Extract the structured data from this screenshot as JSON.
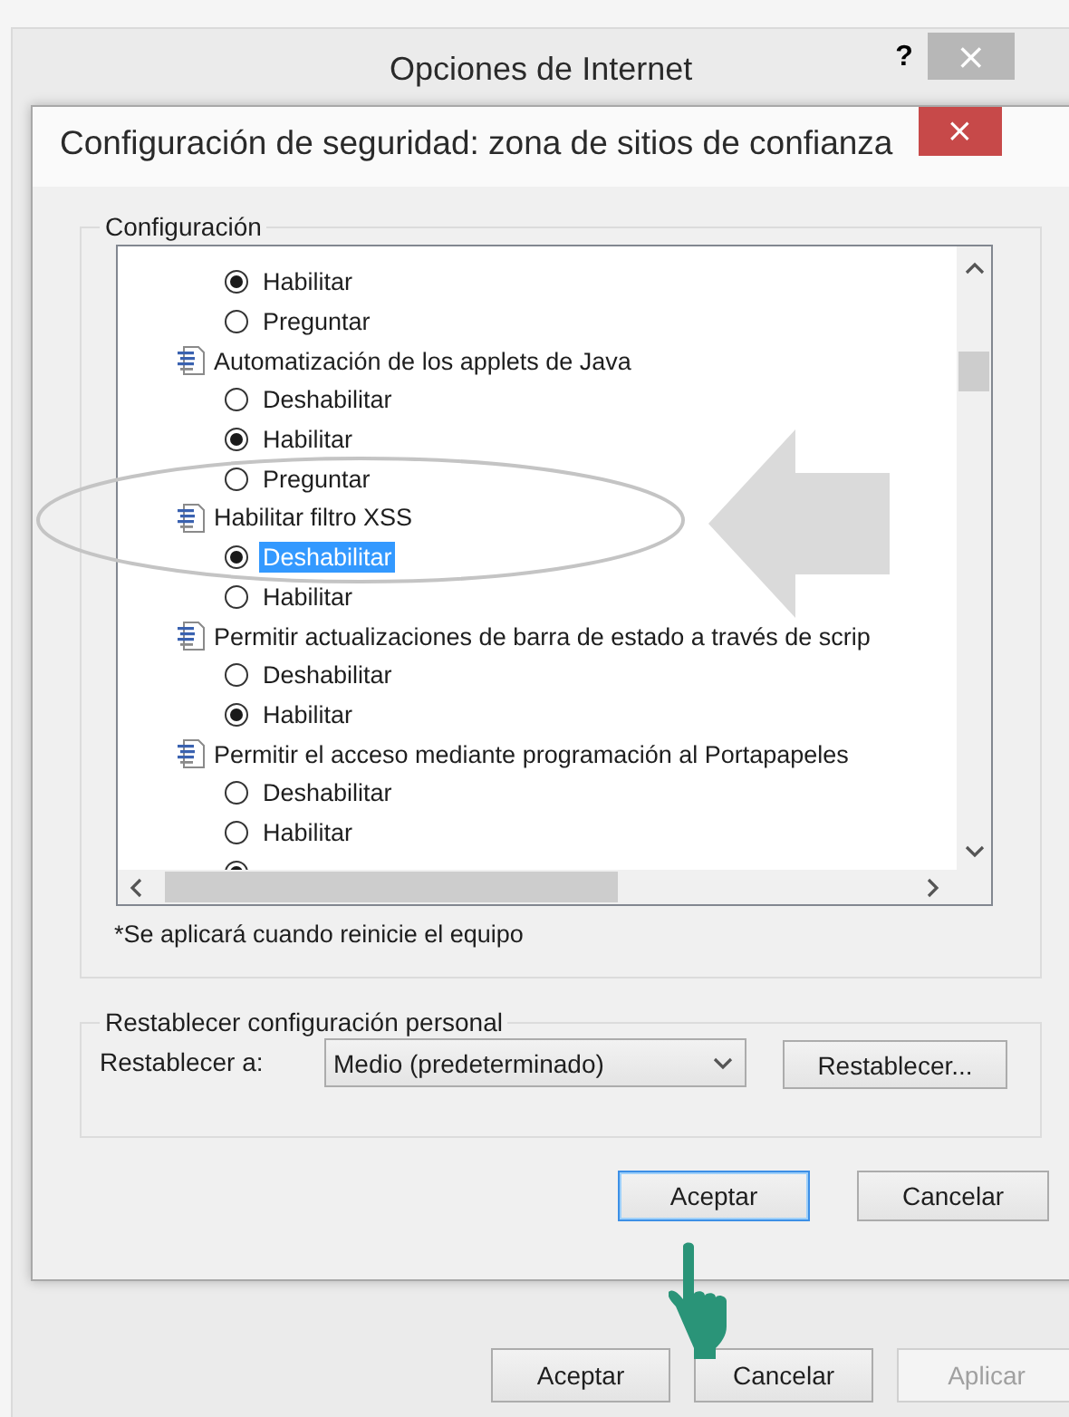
{
  "outer_window": {
    "title": "Opciones de Internet",
    "help": "?",
    "close": "×"
  },
  "dialog": {
    "title": "Configuración de seguridad: zona de sitios de confianza",
    "close": "×",
    "settings_group": {
      "label": "Configuración",
      "items": [
        {
          "kind": "option",
          "label": "Habilitar",
          "checked": true,
          "selected": false
        },
        {
          "kind": "option",
          "label": "Preguntar",
          "checked": false,
          "selected": false
        },
        {
          "kind": "setting",
          "label": "Automatización de los applets de Java"
        },
        {
          "kind": "option",
          "label": "Deshabilitar",
          "checked": false,
          "selected": false
        },
        {
          "kind": "option",
          "label": "Habilitar",
          "checked": true,
          "selected": false
        },
        {
          "kind": "option",
          "label": "Preguntar",
          "checked": false,
          "selected": false
        },
        {
          "kind": "setting",
          "label": "Habilitar filtro XSS"
        },
        {
          "kind": "option",
          "label": "Deshabilitar",
          "checked": true,
          "selected": true
        },
        {
          "kind": "option",
          "label": "Habilitar",
          "checked": false,
          "selected": false
        },
        {
          "kind": "setting",
          "label": "Permitir actualizaciones de barra de estado a través de scrip"
        },
        {
          "kind": "option",
          "label": "Deshabilitar",
          "checked": false,
          "selected": false
        },
        {
          "kind": "option",
          "label": "Habilitar",
          "checked": true,
          "selected": false
        },
        {
          "kind": "setting",
          "label": "Permitir el acceso mediante programación al Portapapeles"
        },
        {
          "kind": "option",
          "label": "Deshabilitar",
          "checked": false,
          "selected": false
        },
        {
          "kind": "option",
          "label": "Habilitar",
          "checked": false,
          "selected": false
        },
        {
          "kind": "option",
          "checked": true,
          "selected": false
        }
      ]
    },
    "note": "*Se aplicará cuando reinicie el equipo",
    "reset_group": {
      "label": "Restablecer configuración personal",
      "reset_label": "Restablecer a:",
      "dropdown_value": "Medio (predeterminado)",
      "reset_button": "Restablecer..."
    },
    "buttons": [
      {
        "label": "Aceptar",
        "focused": true
      },
      {
        "label": "Cancelar",
        "focused": false
      }
    ]
  },
  "buttons": [
    {
      "label": "Aceptar",
      "disabled": false
    },
    {
      "label": "Cancelar",
      "disabled": false
    },
    {
      "label": "Aplicar",
      "disabled": true
    }
  ]
}
